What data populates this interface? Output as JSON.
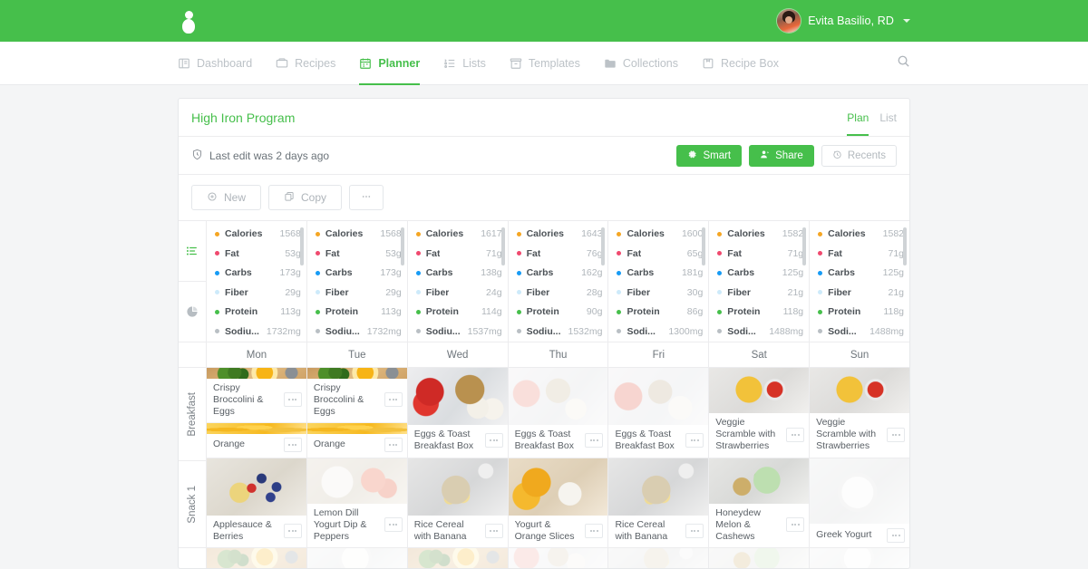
{
  "topbar": {
    "logo_icon": "leaf-person-logo",
    "user_name": "Evita Basilio, RD",
    "caret_icon": "chevron-down-icon",
    "bg_color": "#46bf4b"
  },
  "nav": {
    "items": [
      {
        "label": "Dashboard",
        "icon": "dashboard-icon",
        "active": false
      },
      {
        "label": "Recipes",
        "icon": "recipe-card-icon",
        "active": false
      },
      {
        "label": "Planner",
        "icon": "calendar-icon",
        "active": true
      },
      {
        "label": "Lists",
        "icon": "list-icon",
        "active": false
      },
      {
        "label": "Templates",
        "icon": "archive-box-icon",
        "active": false
      },
      {
        "label": "Collections",
        "icon": "folder-icon",
        "active": false
      },
      {
        "label": "Recipe Box",
        "icon": "recipe-box-icon",
        "active": false
      }
    ],
    "search_icon": "search-icon",
    "accent_color": "#46bf4b",
    "inactive_color": "#bcc2c7"
  },
  "card": {
    "title": "High Iron Program",
    "view_tabs": [
      {
        "label": "Plan",
        "active": true
      },
      {
        "label": "List",
        "active": false
      }
    ],
    "edit_note": "Last edit was 2 days ago",
    "edit_note_icon": "shield-clock-icon",
    "head_buttons": [
      {
        "label": "Smart",
        "icon": "gear-icon",
        "style": "green"
      },
      {
        "label": "Share",
        "icon": "share-user-icon",
        "style": "green"
      },
      {
        "label": "Recents",
        "icon": "clock-icon",
        "style": "ghost"
      }
    ],
    "toolbar_buttons": [
      {
        "label": "New",
        "icon": "plus-circle-icon"
      },
      {
        "label": "Copy",
        "icon": "copy-icon"
      },
      {
        "label": "",
        "icon": "ellipsis-icon"
      }
    ]
  },
  "rail": {
    "icons": [
      {
        "name": "nutrition-list-icon",
        "active": true
      },
      {
        "name": "pie-chart-icon",
        "active": false
      }
    ]
  },
  "nutrition": {
    "labels": [
      "Calories",
      "Fat",
      "Carbs",
      "Fiber",
      "Protein",
      "Sodiu..."
    ],
    "dot_colors": [
      "#f5a623",
      "#f0496e",
      "#169bf5",
      "#cdeafa",
      "#46bf4b",
      "#b9bfc4"
    ],
    "columns": [
      {
        "day": "Mon",
        "values": [
          "1568",
          "53g",
          "173g",
          "29g",
          "113g",
          "1732mg"
        ]
      },
      {
        "day": "Tue",
        "values": [
          "1568",
          "53g",
          "173g",
          "29g",
          "113g",
          "1732mg"
        ]
      },
      {
        "day": "Wed",
        "values": [
          "1617",
          "71g",
          "138g",
          "24g",
          "114g",
          "1537mg"
        ]
      },
      {
        "day": "Thu",
        "values": [
          "1643",
          "76g",
          "162g",
          "28g",
          "90g",
          "1532mg"
        ]
      },
      {
        "day": "Fri",
        "values": [
          "1600",
          "65g",
          "181g",
          "30g",
          "86g",
          "1300mg"
        ],
        "sodium_label": "Sodi..."
      },
      {
        "day": "Sat",
        "values": [
          "1582",
          "71g",
          "125g",
          "21g",
          "118g",
          "1488mg"
        ],
        "sodium_label": "Sodi..."
      },
      {
        "day": "Sun",
        "values": [
          "1582",
          "71g",
          "125g",
          "21g",
          "118g",
          "1488mg"
        ],
        "sodium_label": "Sodi..."
      }
    ]
  },
  "days": [
    "Mon",
    "Tue",
    "Wed",
    "Thu",
    "Fri",
    "Sat",
    "Sun"
  ],
  "meal_rows": [
    {
      "name": "Breakfast",
      "cells": [
        {
          "items": [
            {
              "label": "Crispy Broccolini & Eggs",
              "photo": "ph-brocc"
            },
            {
              "label": "Orange",
              "photo": "ph-orange"
            }
          ]
        },
        {
          "items": [
            {
              "label": "Crispy Broccolini & Eggs",
              "photo": "ph-brocc"
            },
            {
              "label": "Orange",
              "photo": "ph-orange"
            }
          ]
        },
        {
          "items": [
            {
              "label": "Eggs & Toast Breakfast Box",
              "photo": "ph-box1"
            }
          ]
        },
        {
          "items": [
            {
              "label": "Eggs & Toast Breakfast Box",
              "photo": "ph-box2"
            }
          ]
        },
        {
          "items": [
            {
              "label": "Eggs & Toast Breakfast Box",
              "photo": "ph-box3"
            }
          ]
        },
        {
          "items": [
            {
              "label": "Veggie Scramble with Strawberries",
              "photo": "ph-scramble"
            }
          ]
        },
        {
          "items": [
            {
              "label": "Veggie Scramble with Strawberries",
              "photo": "ph-scramble"
            }
          ]
        }
      ]
    },
    {
      "name": "Snack 1",
      "cells": [
        {
          "items": [
            {
              "label": "Applesauce & Berries",
              "photo": "ph-applesauce"
            }
          ]
        },
        {
          "items": [
            {
              "label": "Lemon Dill Yogurt Dip & Peppers",
              "photo": "ph-yogurtdip"
            }
          ]
        },
        {
          "items": [
            {
              "label": "Rice Cereal with Banana",
              "photo": "ph-cereal"
            }
          ]
        },
        {
          "items": [
            {
              "label": "Yogurt & Orange Slices",
              "photo": "ph-yogorange"
            }
          ]
        },
        {
          "items": [
            {
              "label": "Rice Cereal with Banana",
              "photo": "ph-cereal"
            }
          ]
        },
        {
          "items": [
            {
              "label": "Honeydew Melon & Cashews",
              "photo": "ph-melon"
            }
          ]
        },
        {
          "items": [
            {
              "label": "Greek Yogurt",
              "photo": "ph-greek"
            }
          ]
        }
      ]
    },
    {
      "name": "",
      "partial": true,
      "cells": [
        {
          "items": [
            {
              "label": "",
              "photo": "ph-brocc"
            }
          ]
        },
        {
          "items": [
            {
              "label": "",
              "photo": "ph-greek"
            }
          ]
        },
        {
          "items": [
            {
              "label": "",
              "photo": "ph-brocc"
            }
          ]
        },
        {
          "items": [
            {
              "label": "",
              "photo": "ph-box2"
            }
          ]
        },
        {
          "items": [
            {
              "label": "",
              "photo": "ph-cereal"
            }
          ]
        },
        {
          "items": [
            {
              "label": "",
              "photo": "ph-melon"
            }
          ]
        },
        {
          "items": [
            {
              "label": "",
              "photo": "ph-greek"
            }
          ]
        }
      ]
    }
  ],
  "dots_icon": "ellipsis-icon"
}
